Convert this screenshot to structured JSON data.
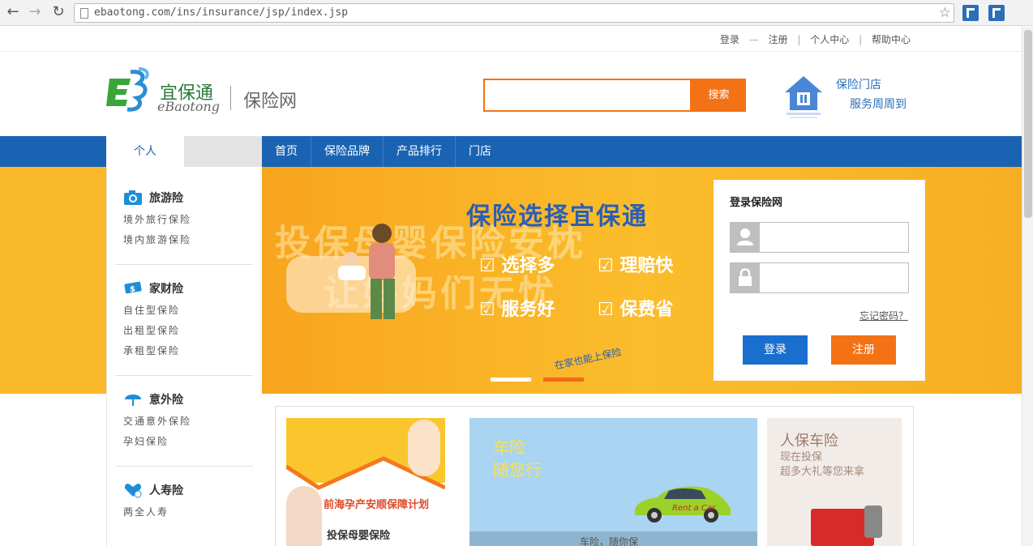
{
  "browser": {
    "url": "ebaotong.com/ins/insurance/jsp/index.jsp"
  },
  "top_links": {
    "login": "登录",
    "dash": "—",
    "register": "注册",
    "sep": "|",
    "user_center": "个人中心",
    "help": "帮助中心"
  },
  "brand": {
    "cn": "宜保通",
    "en": "eBaotong",
    "site": "保险网"
  },
  "search": {
    "value": "",
    "button": "搜索"
  },
  "store": {
    "line1": "保险门店",
    "line2": "服务周周到"
  },
  "nav": {
    "tab_personal": "个人",
    "menu": [
      "首页",
      "保险品牌",
      "产品排行",
      "门店"
    ]
  },
  "sidebar": {
    "categories": [
      {
        "title": "旅游险",
        "icon": "camera-icon",
        "items": [
          "境外旅行保险",
          "境内旅游保险"
        ]
      },
      {
        "title": "家财险",
        "icon": "money-icon",
        "items": [
          "自住型保险",
          "出租型保险",
          "承租型保险"
        ]
      },
      {
        "title": "意外险",
        "icon": "umbrella-icon",
        "items": [
          "交通意外保险",
          "孕妇保险"
        ]
      },
      {
        "title": "人寿险",
        "icon": "heart-icon",
        "items": [
          "两全人寿"
        ]
      }
    ]
  },
  "banner": {
    "title": "保险选择宜保通",
    "big_line1": "投保母婴保险安枕",
    "big_line2": "让妈妈们无忧",
    "features": [
      "选择多",
      "理赔快",
      "服务好",
      "保费省"
    ],
    "slogan": "在家也能上保险",
    "slides_total": 2,
    "active_slide": 2
  },
  "login": {
    "title": "登录保险网",
    "username": "",
    "password": "",
    "forgot": "忘记密码？",
    "login_btn": "登录",
    "register_btn": "注册"
  },
  "promos": {
    "p1_title": "前海孕产安顺保障计划",
    "p1_sub": "投保母婴保险",
    "p2_line1": "车险",
    "p2_line2": "随您行",
    "p2_caption": "车险，随你保",
    "p2_car": "Rent a Car",
    "p3_title": "人保车险",
    "p3_line1": "现在投保",
    "p3_line2": "超多大礼等您来拿"
  },
  "colors": {
    "nav_blue": "#1a63b3",
    "accent_orange": "#f47216",
    "banner_yellow": "#f9b82a"
  }
}
